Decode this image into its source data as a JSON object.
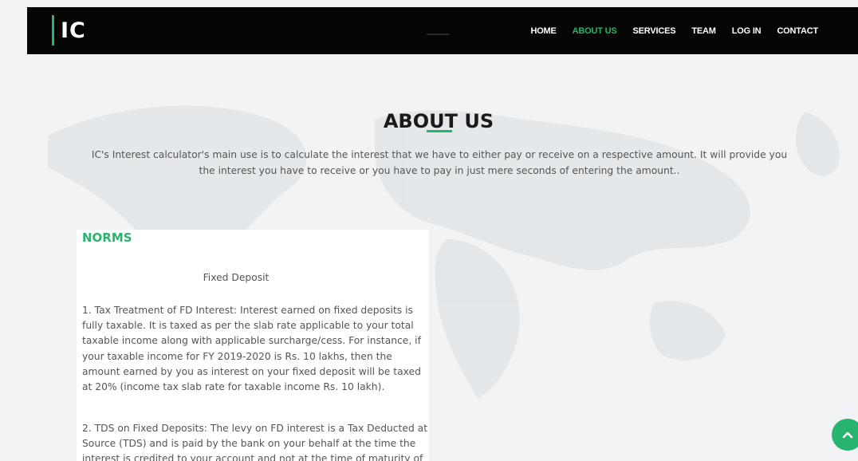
{
  "brand": {
    "logo_text": "IC",
    "accent_color": "#27b46f"
  },
  "nav": {
    "items": [
      {
        "label": "HOME",
        "active": false
      },
      {
        "label": "ABOUT US",
        "active": true
      },
      {
        "label": "SERVICES",
        "active": false
      },
      {
        "label": "TEAM",
        "active": false
      },
      {
        "label": "LOG IN",
        "active": false
      },
      {
        "label": "CONTACT",
        "active": false
      }
    ]
  },
  "about": {
    "heading": "ABOUT US",
    "intro": "IC's Interest calculator's main use is to calculate the interest that we have to either pay or receive on a respective amount. It will provide you the interest you have to receive or you have to pay in just mere seconds of entering the amount.."
  },
  "norms": {
    "title": "NORMS",
    "subtitle": "Fixed Deposit",
    "paragraph_1": "1. Tax Treatment of FD Interest: Interest earned on fixed deposits is fully taxable. It is taxed as per the slab rate applicable to your total taxable income along with applicable surcharge/cess. For instance, if your taxable income for FY 2019-2020 is Rs. 10 lakhs, then the amount earned by you as interest on your fixed deposit will be taxed at 20% (income tax slab rate for taxable income Rs. 10 lakh).",
    "paragraph_2": "2. TDS on Fixed Deposits: The levy on FD interest is a Tax Deducted at Source (TDS) and is paid by the bank on your behalf at the time the interest is credited to your account and not at the time of maturity of"
  },
  "icons": {
    "scroll_top": "chevron-up-icon"
  }
}
